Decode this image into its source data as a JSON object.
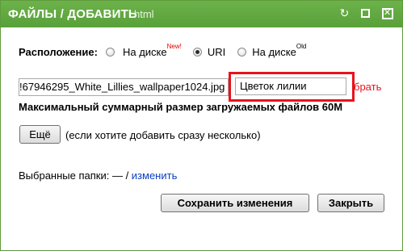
{
  "titlebar": {
    "title": "ФАЙЛЫ / ДОБАВИТЬ",
    "subtitle": "html",
    "icons": [
      "refresh-icon",
      "maximize-icon",
      "close-icon"
    ],
    "accent_color": "#5ea63f"
  },
  "location": {
    "label": "Расположение:",
    "options": [
      {
        "label": "На диске",
        "badge": "New!",
        "badge_color": "#e00000",
        "selected": false
      },
      {
        "label": "URI",
        "badge": "",
        "selected": true
      },
      {
        "label": "На диске",
        "badge": "Old",
        "selected": false
      }
    ]
  },
  "file_row": {
    "file_value": "!67946295_White_Lillies_wallpaper1024.jpg",
    "name_value": "Цветок лилии",
    "remove_label": "брать",
    "highlight_color": "#e8121c"
  },
  "max_size_text": "Максимальный суммарный размер загружаемых файлов 60M",
  "more": {
    "button_label": "Ещё",
    "hint": "(если хотите добавить сразу несколько)"
  },
  "folders": {
    "label": "Выбранные папки: —",
    "separator": " / ",
    "change_link": "изменить"
  },
  "actions": {
    "save_label": "Сохранить изменения",
    "close_label": "Закрыть"
  }
}
